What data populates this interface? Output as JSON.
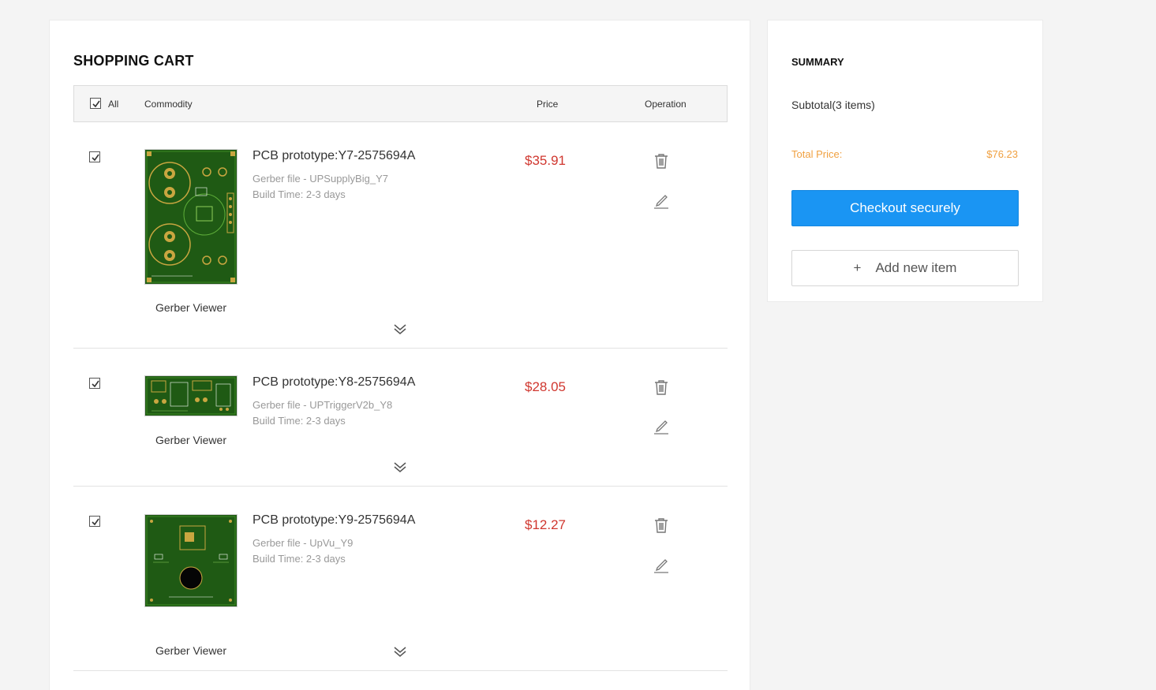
{
  "cart": {
    "title": "SHOPPING CART",
    "header": {
      "all_label": "All",
      "all_checked": true,
      "commodity": "Commodity",
      "price": "Price",
      "operation": "Operation"
    },
    "items": [
      {
        "checked": true,
        "name": "PCB prototype:Y7-2575694A",
        "gerber": "Gerber file - UPSupplyBig_Y7",
        "build": "Build Time: 2-3 days",
        "price": "$35.91",
        "viewer": "Gerber Viewer"
      },
      {
        "checked": true,
        "name": "PCB prototype:Y8-2575694A",
        "gerber": "Gerber file - UPTriggerV2b_Y8",
        "build": "Build Time: 2-3 days",
        "price": "$28.05",
        "viewer": "Gerber Viewer"
      },
      {
        "checked": true,
        "name": "PCB prototype:Y9-2575694A",
        "gerber": "Gerber file - UpVu_Y9",
        "build": "Build Time: 2-3 days",
        "price": "$12.27",
        "viewer": "Gerber Viewer"
      }
    ]
  },
  "summary": {
    "title": "SUMMARY",
    "subtotal": "Subtotal(3 items)",
    "total_label": "Total Price:",
    "total_value": "$76.23",
    "checkout": "Checkout securely",
    "add_plus": "+",
    "add_item": "Add new item"
  },
  "colors": {
    "accent": "#1a95f3",
    "price": "#d0372f",
    "total": "#f0a040",
    "pcb_green": "#1f5a14"
  }
}
